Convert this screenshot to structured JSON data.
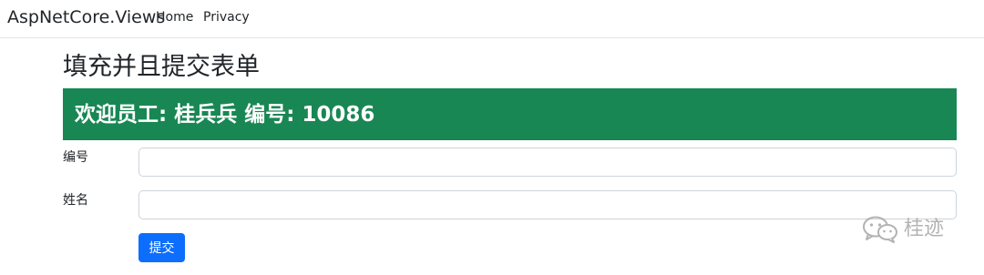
{
  "navbar": {
    "brand": "AspNetCore.Views",
    "links": [
      {
        "label": "Home"
      },
      {
        "label": "Privacy"
      }
    ]
  },
  "main": {
    "title": "填充并且提交表单",
    "banner": {
      "text": "欢迎员工: 桂兵兵 编号: 10086",
      "color": "#198754"
    },
    "form": {
      "fields": [
        {
          "label": "编号",
          "value": ""
        },
        {
          "label": "姓名",
          "value": ""
        }
      ],
      "submit_label": "提交",
      "submit_color": "#0d6efd"
    }
  },
  "watermark": {
    "icon": "wechat-icon",
    "text": "桂迹"
  }
}
